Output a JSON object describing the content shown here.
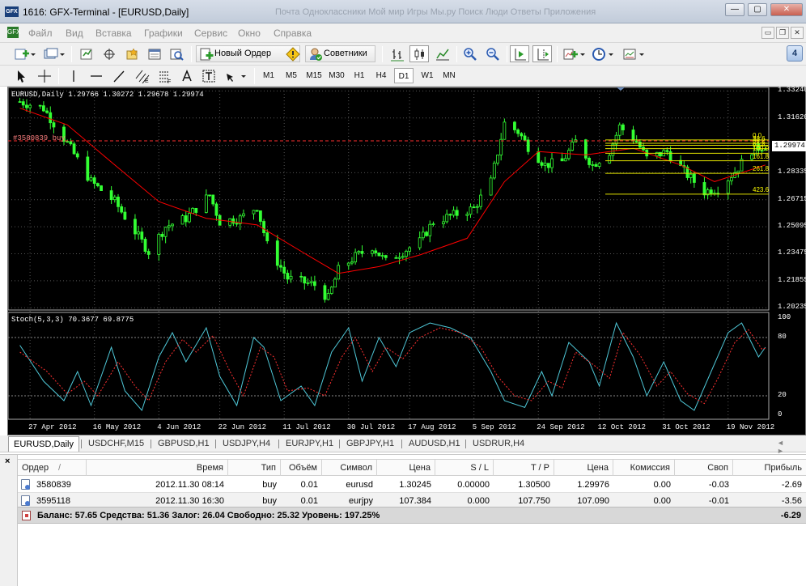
{
  "window": {
    "app_logo": "GFX",
    "title": "1616: GFX-Terminal - [EURUSD,Daily]",
    "ghost_tabs": "Почта   Одноклассники   Мой мир   Игры   Мы.ру   Поиск   Люди   Ответы   Приложения",
    "controls": [
      "—",
      "▢",
      "✕"
    ]
  },
  "menu": {
    "logo": "GFX",
    "items": [
      "Файл",
      "Вид",
      "Вставка",
      "Графики",
      "Сервис",
      "Окно",
      "Справка"
    ],
    "mdi_controls": [
      "▭",
      "❐",
      "✕"
    ]
  },
  "toolbar1": {
    "new_order_label": "Новый Ордер",
    "advisors_label": "Советники",
    "badge": "4"
  },
  "toolbar2": {
    "timeframes": [
      "M1",
      "M5",
      "M15",
      "M30",
      "H1",
      "H4",
      "D1",
      "W1",
      "MN"
    ],
    "active_timeframe": "D1"
  },
  "chart": {
    "info": "EURUSD,Daily  1.29766 1.30272 1.29678 1.29974",
    "order_line_label": "#3580839 buy",
    "indicator_label": "Stoch(5,3,3) 70.3677 69.8775",
    "current_price": "1.29974",
    "fib_labels": [
      "0.0",
      "23.6",
      "38.2",
      "61.8",
      "100.0",
      "161.8",
      "261.8",
      "423.6"
    ],
    "colors": {
      "background": "#000000",
      "candles": "#33ff33",
      "ma": "#ff0000",
      "fib": "#ffff00",
      "stoch_main": "#4fc8d8",
      "stoch_signal": "#ff3030"
    }
  },
  "chart_data": {
    "type": "candlestick",
    "symbol": "EURUSD",
    "timeframe": "Daily",
    "ohlc_last": {
      "open": 1.29766,
      "high": 1.30272,
      "low": 1.29678,
      "close": 1.29974
    },
    "price_axis_ticks": [
      "1.33240",
      "1.31620",
      "1.29974",
      "1.28335",
      "1.26715",
      "1.25095",
      "1.23475",
      "1.21855",
      "1.20235"
    ],
    "ylim": [
      1.201,
      1.3345
    ],
    "date_ticks": [
      "27 Apr 2012",
      "16 May 2012",
      "4 Jun 2012",
      "22 Jun 2012",
      "11 Jul 2012",
      "30 Jul 2012",
      "17 Aug 2012",
      "5 Sep 2012",
      "24 Sep 2012",
      "12 Oct 2012",
      "31 Oct 2012",
      "19 Nov 2012"
    ],
    "stoch_ticks": [
      "100",
      "80",
      "20",
      "0"
    ],
    "stoch_levels": [
      80,
      20
    ],
    "close_path": [
      [
        "2012-04-24",
        1.326
      ],
      [
        "2012-05-01",
        1.322
      ],
      [
        "2012-05-08",
        1.301
      ],
      [
        "2012-05-15",
        1.278
      ],
      [
        "2012-05-22",
        1.266
      ],
      [
        "2012-05-29",
        1.245
      ],
      [
        "2012-06-01",
        1.236
      ],
      [
        "2012-06-06",
        1.251
      ],
      [
        "2012-06-12",
        1.256
      ],
      [
        "2012-06-19",
        1.27
      ],
      [
        "2012-06-22",
        1.254
      ],
      [
        "2012-06-28",
        1.256
      ],
      [
        "2012-07-03",
        1.263
      ],
      [
        "2012-07-06",
        1.24
      ],
      [
        "2012-07-12",
        1.22
      ],
      [
        "2012-07-20",
        1.216
      ],
      [
        "2012-07-24",
        1.208
      ],
      [
        "2012-07-27",
        1.225
      ],
      [
        "2012-08-01",
        1.233
      ],
      [
        "2012-08-06",
        1.239
      ],
      [
        "2012-08-10",
        1.23
      ],
      [
        "2012-08-15",
        1.236
      ],
      [
        "2012-08-20",
        1.242
      ],
      [
        "2012-08-24",
        1.254
      ],
      [
        "2012-08-30",
        1.258
      ],
      [
        "2012-09-05",
        1.262
      ],
      [
        "2012-09-10",
        1.278
      ],
      [
        "2012-09-14",
        1.313
      ],
      [
        "2012-09-18",
        1.308
      ],
      [
        "2012-09-21",
        1.299
      ],
      [
        "2012-09-26",
        1.288
      ],
      [
        "2012-10-01",
        1.29
      ],
      [
        "2012-10-05",
        1.302
      ],
      [
        "2012-10-10",
        1.288
      ],
      [
        "2012-10-15",
        1.296
      ],
      [
        "2012-10-18",
        1.311
      ],
      [
        "2012-10-23",
        1.302
      ],
      [
        "2012-10-26",
        1.292
      ],
      [
        "2012-11-01",
        1.296
      ],
      [
        "2012-11-06",
        1.284
      ],
      [
        "2012-11-12",
        1.272
      ],
      [
        "2012-11-16",
        1.274
      ],
      [
        "2012-11-21",
        1.284
      ],
      [
        "2012-11-26",
        1.297
      ],
      [
        "2012-11-30",
        1.2997
      ]
    ],
    "ma_path": [
      [
        "2012-04-24",
        1.322
      ],
      [
        "2012-05-08",
        1.312
      ],
      [
        "2012-05-22",
        1.288
      ],
      [
        "2012-06-04",
        1.266
      ],
      [
        "2012-06-18",
        1.256
      ],
      [
        "2012-07-03",
        1.252
      ],
      [
        "2012-07-17",
        1.235
      ],
      [
        "2012-07-27",
        1.223
      ],
      [
        "2012-08-08",
        1.227
      ],
      [
        "2012-08-20",
        1.234
      ],
      [
        "2012-09-03",
        1.244
      ],
      [
        "2012-09-14",
        1.278
      ],
      [
        "2012-09-24",
        1.296
      ],
      [
        "2012-10-08",
        1.294
      ],
      [
        "2012-10-22",
        1.298
      ],
      [
        "2012-11-05",
        1.288
      ],
      [
        "2012-11-15",
        1.278
      ],
      [
        "2012-11-30",
        1.288
      ]
    ],
    "order_price": 1.30245,
    "fib_levels": [
      {
        "label": "0.0",
        "price": 1.303
      },
      {
        "label": "23.6",
        "price": 1.301
      },
      {
        "label": "38.2",
        "price": 1.2998
      },
      {
        "label": "61.8",
        "price": 1.2978
      },
      {
        "label": "100.0",
        "price": 1.295
      },
      {
        "label": "161.8",
        "price": 1.2905
      },
      {
        "label": "261.8",
        "price": 1.283
      },
      {
        "label": "423.6",
        "price": 1.2705
      }
    ],
    "stoch_main": [
      [
        "2012-04-24",
        72
      ],
      [
        "2012-05-01",
        35
      ],
      [
        "2012-05-07",
        15
      ],
      [
        "2012-05-11",
        45
      ],
      [
        "2012-05-15",
        10
      ],
      [
        "2012-05-21",
        70
      ],
      [
        "2012-05-25",
        25
      ],
      [
        "2012-05-30",
        5
      ],
      [
        "2012-06-04",
        60
      ],
      [
        "2012-06-08",
        85
      ],
      [
        "2012-06-12",
        55
      ],
      [
        "2012-06-18",
        90
      ],
      [
        "2012-06-22",
        40
      ],
      [
        "2012-06-27",
        10
      ],
      [
        "2012-07-02",
        80
      ],
      [
        "2012-07-05",
        70
      ],
      [
        "2012-07-10",
        15
      ],
      [
        "2012-07-16",
        30
      ],
      [
        "2012-07-20",
        10
      ],
      [
        "2012-07-25",
        65
      ],
      [
        "2012-07-30",
        90
      ],
      [
        "2012-08-03",
        35
      ],
      [
        "2012-08-08",
        80
      ],
      [
        "2012-08-13",
        50
      ],
      [
        "2012-08-17",
        85
      ],
      [
        "2012-08-23",
        95
      ],
      [
        "2012-08-29",
        90
      ],
      [
        "2012-09-04",
        80
      ],
      [
        "2012-09-10",
        45
      ],
      [
        "2012-09-14",
        15
      ],
      [
        "2012-09-20",
        8
      ],
      [
        "2012-09-25",
        45
      ],
      [
        "2012-09-28",
        20
      ],
      [
        "2012-10-03",
        75
      ],
      [
        "2012-10-09",
        55
      ],
      [
        "2012-10-12",
        30
      ],
      [
        "2012-10-17",
        95
      ],
      [
        "2012-10-22",
        60
      ],
      [
        "2012-10-26",
        20
      ],
      [
        "2012-10-31",
        55
      ],
      [
        "2012-11-05",
        15
      ],
      [
        "2012-11-09",
        5
      ],
      [
        "2012-11-14",
        45
      ],
      [
        "2012-11-19",
        85
      ],
      [
        "2012-11-23",
        95
      ],
      [
        "2012-11-28",
        60
      ],
      [
        "2012-11-30",
        70
      ]
    ],
    "stoch_signal": [
      [
        "2012-04-24",
        65
      ],
      [
        "2012-05-02",
        45
      ],
      [
        "2012-05-08",
        22
      ],
      [
        "2012-05-13",
        35
      ],
      [
        "2012-05-17",
        20
      ],
      [
        "2012-05-23",
        55
      ],
      [
        "2012-05-28",
        30
      ],
      [
        "2012-06-01",
        15
      ],
      [
        "2012-06-06",
        55
      ],
      [
        "2012-06-11",
        78
      ],
      [
        "2012-06-15",
        65
      ],
      [
        "2012-06-20",
        82
      ],
      [
        "2012-06-25",
        45
      ],
      [
        "2012-06-29",
        20
      ],
      [
        "2012-07-04",
        70
      ],
      [
        "2012-07-08",
        60
      ],
      [
        "2012-07-12",
        25
      ],
      [
        "2012-07-18",
        28
      ],
      [
        "2012-07-23",
        20
      ],
      [
        "2012-07-28",
        60
      ],
      [
        "2012-08-01",
        80
      ],
      [
        "2012-08-06",
        45
      ],
      [
        "2012-08-10",
        70
      ],
      [
        "2012-08-15",
        58
      ],
      [
        "2012-08-20",
        80
      ],
      [
        "2012-08-26",
        90
      ],
      [
        "2012-09-01",
        85
      ],
      [
        "2012-09-07",
        70
      ],
      [
        "2012-09-12",
        40
      ],
      [
        "2012-09-17",
        20
      ],
      [
        "2012-09-22",
        15
      ],
      [
        "2012-09-27",
        35
      ],
      [
        "2012-10-01",
        28
      ],
      [
        "2012-10-05",
        65
      ],
      [
        "2012-10-11",
        50
      ],
      [
        "2012-10-15",
        38
      ],
      [
        "2012-10-19",
        85
      ],
      [
        "2012-10-24",
        62
      ],
      [
        "2012-10-29",
        30
      ],
      [
        "2012-11-02",
        45
      ],
      [
        "2012-11-07",
        22
      ],
      [
        "2012-11-12",
        12
      ],
      [
        "2012-11-16",
        38
      ],
      [
        "2012-11-21",
        75
      ],
      [
        "2012-11-25",
        88
      ],
      [
        "2012-11-29",
        68
      ],
      [
        "2012-11-30",
        69
      ]
    ]
  },
  "chart_tabs": [
    "EURUSD,Daily",
    "USDCHF,M15",
    "GBPUSD,H1",
    "USDJPY,H4",
    "EURJPY,H1",
    "GBPJPY,H1",
    "AUDUSD,H1",
    "USDRUR,H4"
  ],
  "chart_tab_arrows": "◄ ►",
  "terminal": {
    "close": "×",
    "columns": [
      "Ордер",
      "/",
      "Время",
      "Тип",
      "Объём",
      "Символ",
      "Цена",
      "S / L",
      "T / P",
      "Цена",
      "Комиссия",
      "Своп",
      "Прибыль"
    ],
    "rows": [
      {
        "order": "3580839",
        "time": "2012.11.30 08:14",
        "type": "buy",
        "volume": "0.01",
        "symbol": "eurusd",
        "price": "1.30245",
        "sl": "0.00000",
        "tp": "1.30500",
        "cur_price": "1.29976",
        "commission": "0.00",
        "swap": "-0.03",
        "profit": "-2.69"
      },
      {
        "order": "3595118",
        "time": "2012.11.30 16:30",
        "type": "buy",
        "volume": "0.01",
        "symbol": "eurjpy",
        "price": "107.384",
        "sl": "0.000",
        "tp": "107.750",
        "cur_price": "107.090",
        "commission": "0.00",
        "swap": "-0.01",
        "profit": "-3.56"
      }
    ],
    "balance_text": "Баланс: 57.65  Средства: 51.36  Залог: 26.04  Свободно: 25.32  Уровень: 197.25%",
    "total_profit": "-6.29"
  }
}
